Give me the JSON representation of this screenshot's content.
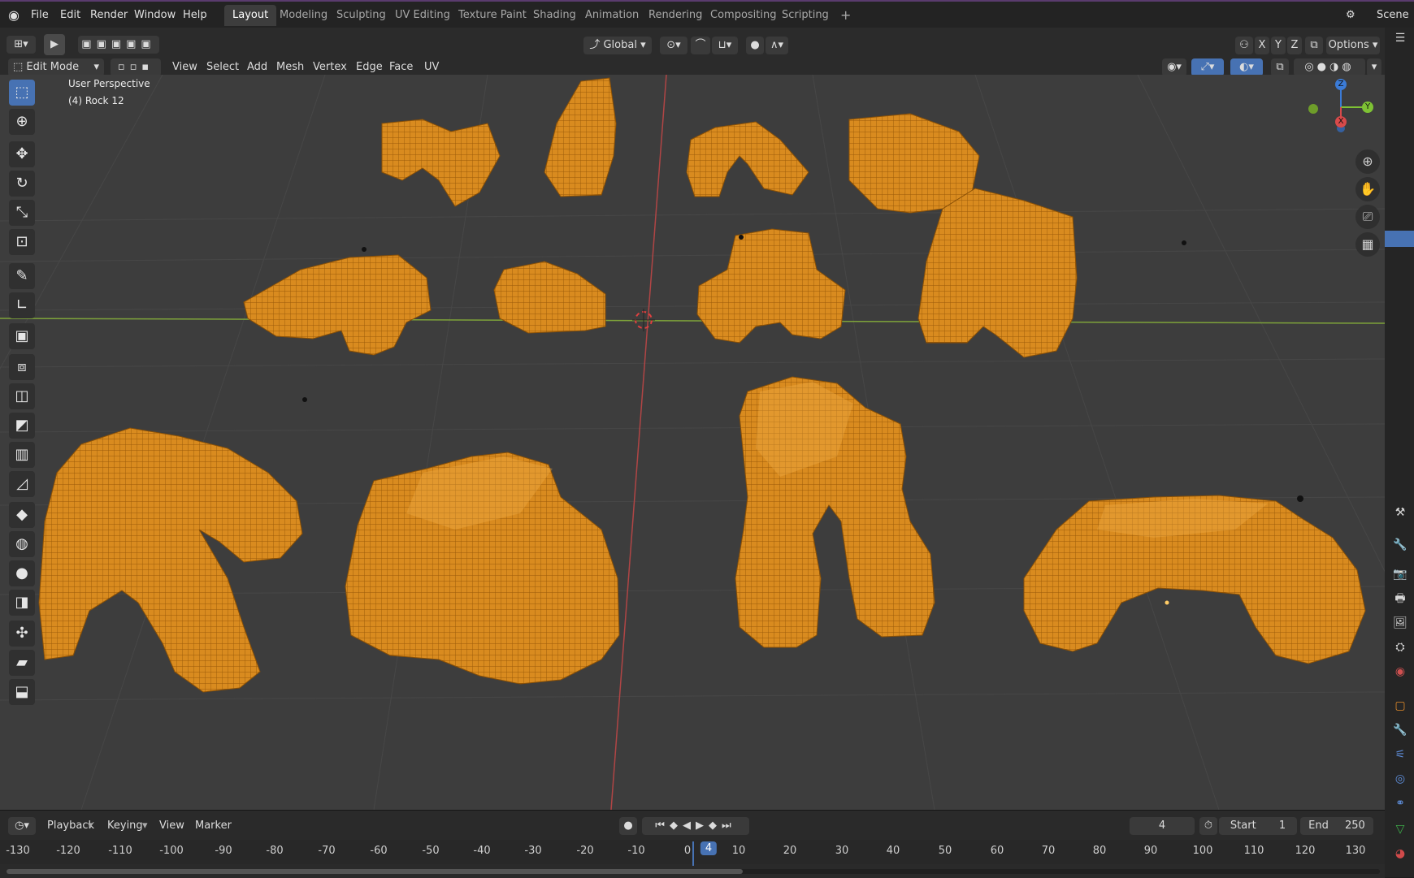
{
  "menubar": {
    "items": [
      "File",
      "Edit",
      "Render",
      "Window",
      "Help"
    ],
    "workspaces": [
      "Layout",
      "Modeling",
      "Sculpting",
      "UV Editing",
      "Texture Paint",
      "Shading",
      "Animation",
      "Rendering",
      "Compositing",
      "Scripting"
    ],
    "active_workspace": "Layout",
    "add_tab": "+",
    "scene_label": "Scene"
  },
  "header": {
    "orientation": "Global",
    "axes": [
      "X",
      "Y",
      "Z"
    ],
    "options_label": "Options",
    "mode": "Edit Mode",
    "menus": [
      "View",
      "Select",
      "Add",
      "Mesh",
      "Vertex",
      "Edge",
      "Face",
      "UV"
    ]
  },
  "viewport": {
    "view_name": "User Perspective",
    "object_info": "(4) Rock 12",
    "gizmo_axes": {
      "x": "X",
      "y": "Y",
      "z": "Z"
    },
    "mesh_color": "#d98b1f",
    "wire_color": "#9a5a08",
    "x_axis_color": "#b04545",
    "y_axis_color": "#7ea33a"
  },
  "toolbar": {
    "tools": [
      "select-box",
      "cursor",
      "move",
      "rotate",
      "scale",
      "transform",
      "annotate",
      "measure",
      "add-cube",
      "extrude-region",
      "inset-faces",
      "bevel",
      "loop-cut",
      "knife",
      "poly-build",
      "spin",
      "smooth",
      "edge-slide",
      "shrink-fatten",
      "shear",
      "rip-region"
    ]
  },
  "timeline": {
    "menus": [
      "Playback",
      "Keying",
      "View",
      "Marker"
    ],
    "current_frame": "4",
    "start_label": "Start",
    "start_value": "1",
    "end_label": "End",
    "end_value": "250",
    "ticks": [
      "-130",
      "-120",
      "-110",
      "-100",
      "-90",
      "-80",
      "-70",
      "-60",
      "-50",
      "-40",
      "-30",
      "-20",
      "-10",
      "0",
      "4",
      "10",
      "20",
      "30",
      "40",
      "50",
      "60",
      "70",
      "80",
      "90",
      "100",
      "110",
      "120",
      "130"
    ]
  }
}
